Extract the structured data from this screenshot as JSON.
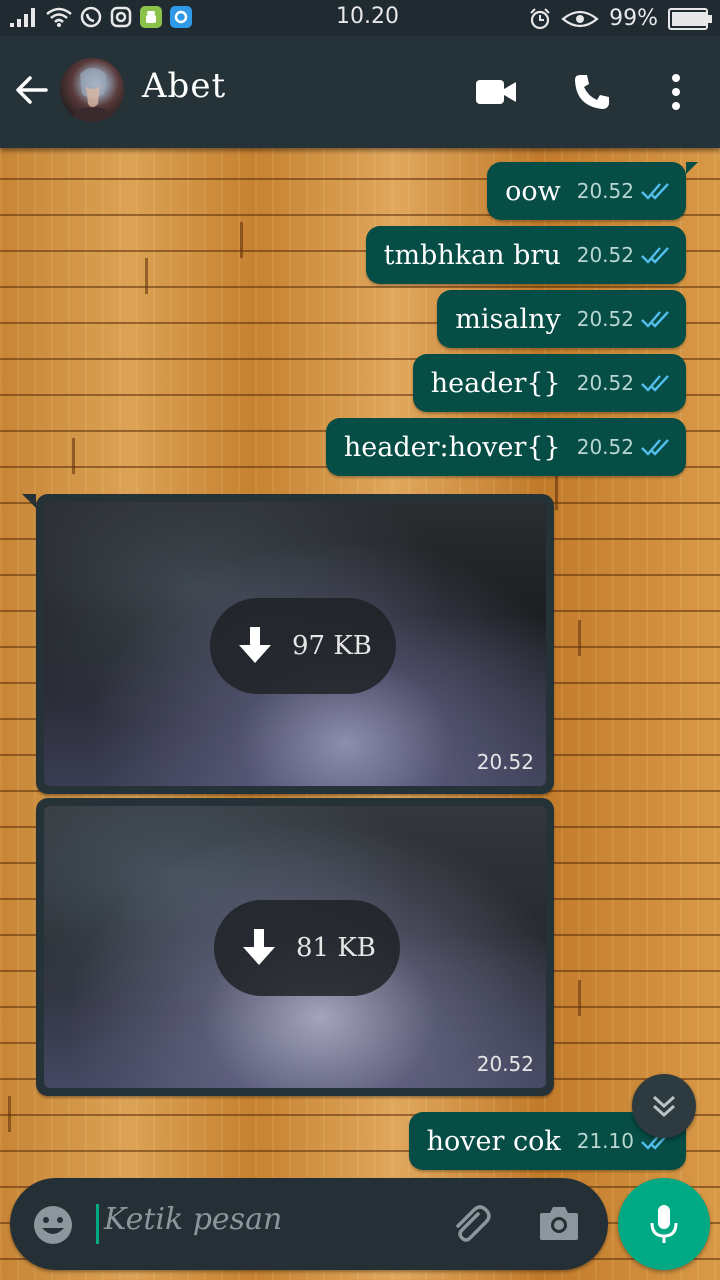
{
  "status_bar": {
    "time": "10.20",
    "battery": "99%",
    "battery_level": 0.99
  },
  "header": {
    "contact_name": "Abet",
    "icons": [
      "back-arrow-icon",
      "video-call-icon",
      "voice-call-icon",
      "more-options-icon"
    ]
  },
  "messages": {
    "outgoing": [
      {
        "text": "oow",
        "time": "20.52"
      },
      {
        "text": "tmbhkan bru",
        "time": "20.52"
      },
      {
        "text": "misalny",
        "time": "20.52"
      },
      {
        "text": "header{}",
        "time": "20.52"
      },
      {
        "text": "header:hover{}",
        "time": "20.52"
      }
    ],
    "media": [
      {
        "size": "97 KB",
        "time": "20.52"
      },
      {
        "size": "81 KB",
        "time": "20.52"
      }
    ],
    "last": {
      "text": "hover cok",
      "time": "21.10"
    }
  },
  "composer": {
    "placeholder": "Ketik pesan"
  },
  "colors": {
    "outgoing_bubble": "#054d45",
    "incoming_bubble": "#253238",
    "accent": "#00a884",
    "read_ticks": "#53bdeb"
  }
}
